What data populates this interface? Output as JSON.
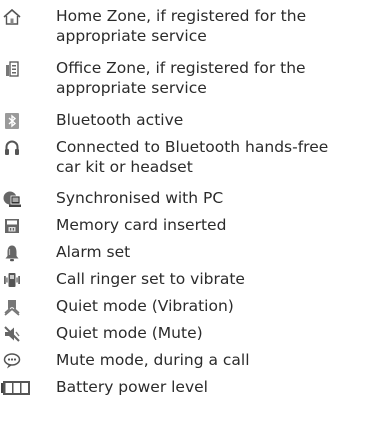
{
  "items": [
    {
      "icon": "home-zone-icon",
      "text": "Home Zone, if registered for the\nappropriate service"
    },
    {
      "icon": "office-zone-icon",
      "text": "Office Zone, if registered for the\nappropriate service"
    },
    {
      "icon": "bluetooth-icon",
      "text": "Bluetooth active"
    },
    {
      "icon": "headset-icon",
      "text": "Connected to Bluetooth hands-free\ncar kit or headset"
    },
    {
      "icon": "pc-sync-icon",
      "text": "Synchronised with PC"
    },
    {
      "icon": "memory-card-icon",
      "text": "Memory card inserted"
    },
    {
      "icon": "alarm-icon",
      "text": "Alarm set"
    },
    {
      "icon": "vibrate-icon",
      "text": "Call ringer set to vibrate"
    },
    {
      "icon": "quiet-vibration-icon",
      "text": "Quiet mode (Vibration)"
    },
    {
      "icon": "quiet-mute-icon",
      "text": "Quiet mode (Mute)"
    },
    {
      "icon": "call-mute-icon",
      "text": "Mute mode, during a call"
    },
    {
      "icon": "battery-icon",
      "text": "Battery power level"
    }
  ]
}
